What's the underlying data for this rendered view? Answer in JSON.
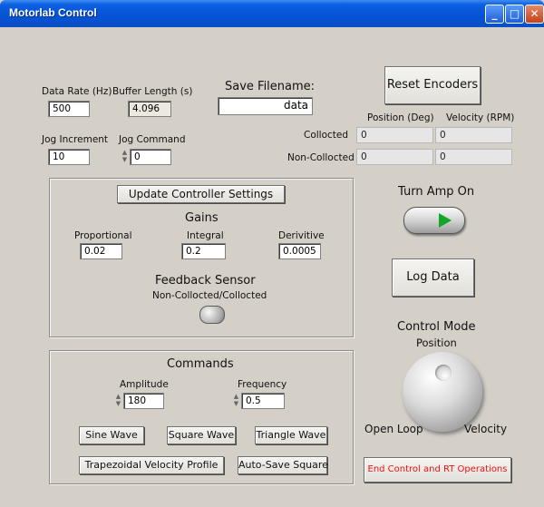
{
  "window": {
    "title": "Motorlab Control",
    "min": "_",
    "max": "□",
    "close": "✕"
  },
  "acquisition": {
    "data_rate_label": "Data Rate (Hz)",
    "data_rate_value": "500",
    "buffer_length_label": "Buffer Length (s)",
    "buffer_length_value": "4.096",
    "save_filename_label": "Save Filename:",
    "save_filename_value": "data",
    "jog_increment_label": "Jog Increment",
    "jog_increment_value": "10",
    "jog_command_label": "Jog Command",
    "jog_command_value": "0"
  },
  "encoders": {
    "reset_label": "Reset Encoders",
    "position_header": "Position (Deg)",
    "velocity_header": "Velocity (RPM)",
    "rows": [
      {
        "label": "Collocted",
        "position": "0",
        "velocity": "0"
      },
      {
        "label": "Non-Collocted",
        "position": "0",
        "velocity": "0"
      }
    ]
  },
  "controller": {
    "update_label": "Update Controller Settings",
    "gains_label": "Gains",
    "proportional_label": "Proportional",
    "proportional_value": "0.02",
    "integral_label": "Integral",
    "integral_value": "0.2",
    "derivative_label": "Derivitive",
    "derivative_value": "0.0005",
    "feedback_label": "Feedback Sensor",
    "feedback_sub": "Non-Collocted/Collocted"
  },
  "commands": {
    "title": "Commands",
    "amplitude_label": "Amplitude",
    "amplitude_value": "180",
    "frequency_label": "Frequency",
    "frequency_value": "0.5",
    "sine": "Sine Wave",
    "square": "Square Wave",
    "triangle": "Triangle Wave",
    "trapezoidal": "Trapezoidal Velocity Profile",
    "autosave": "Auto-Save Square"
  },
  "right_panel": {
    "amp_label": "Turn Amp On",
    "log_label": "Log Data",
    "control_mode_label": "Control Mode",
    "position_label": "Position",
    "open_loop_label": "Open Loop",
    "velocity_label": "Velocity",
    "end_label": "End Control and RT Operations",
    "led_color": "#13a62b",
    "end_color": "#e11111"
  }
}
